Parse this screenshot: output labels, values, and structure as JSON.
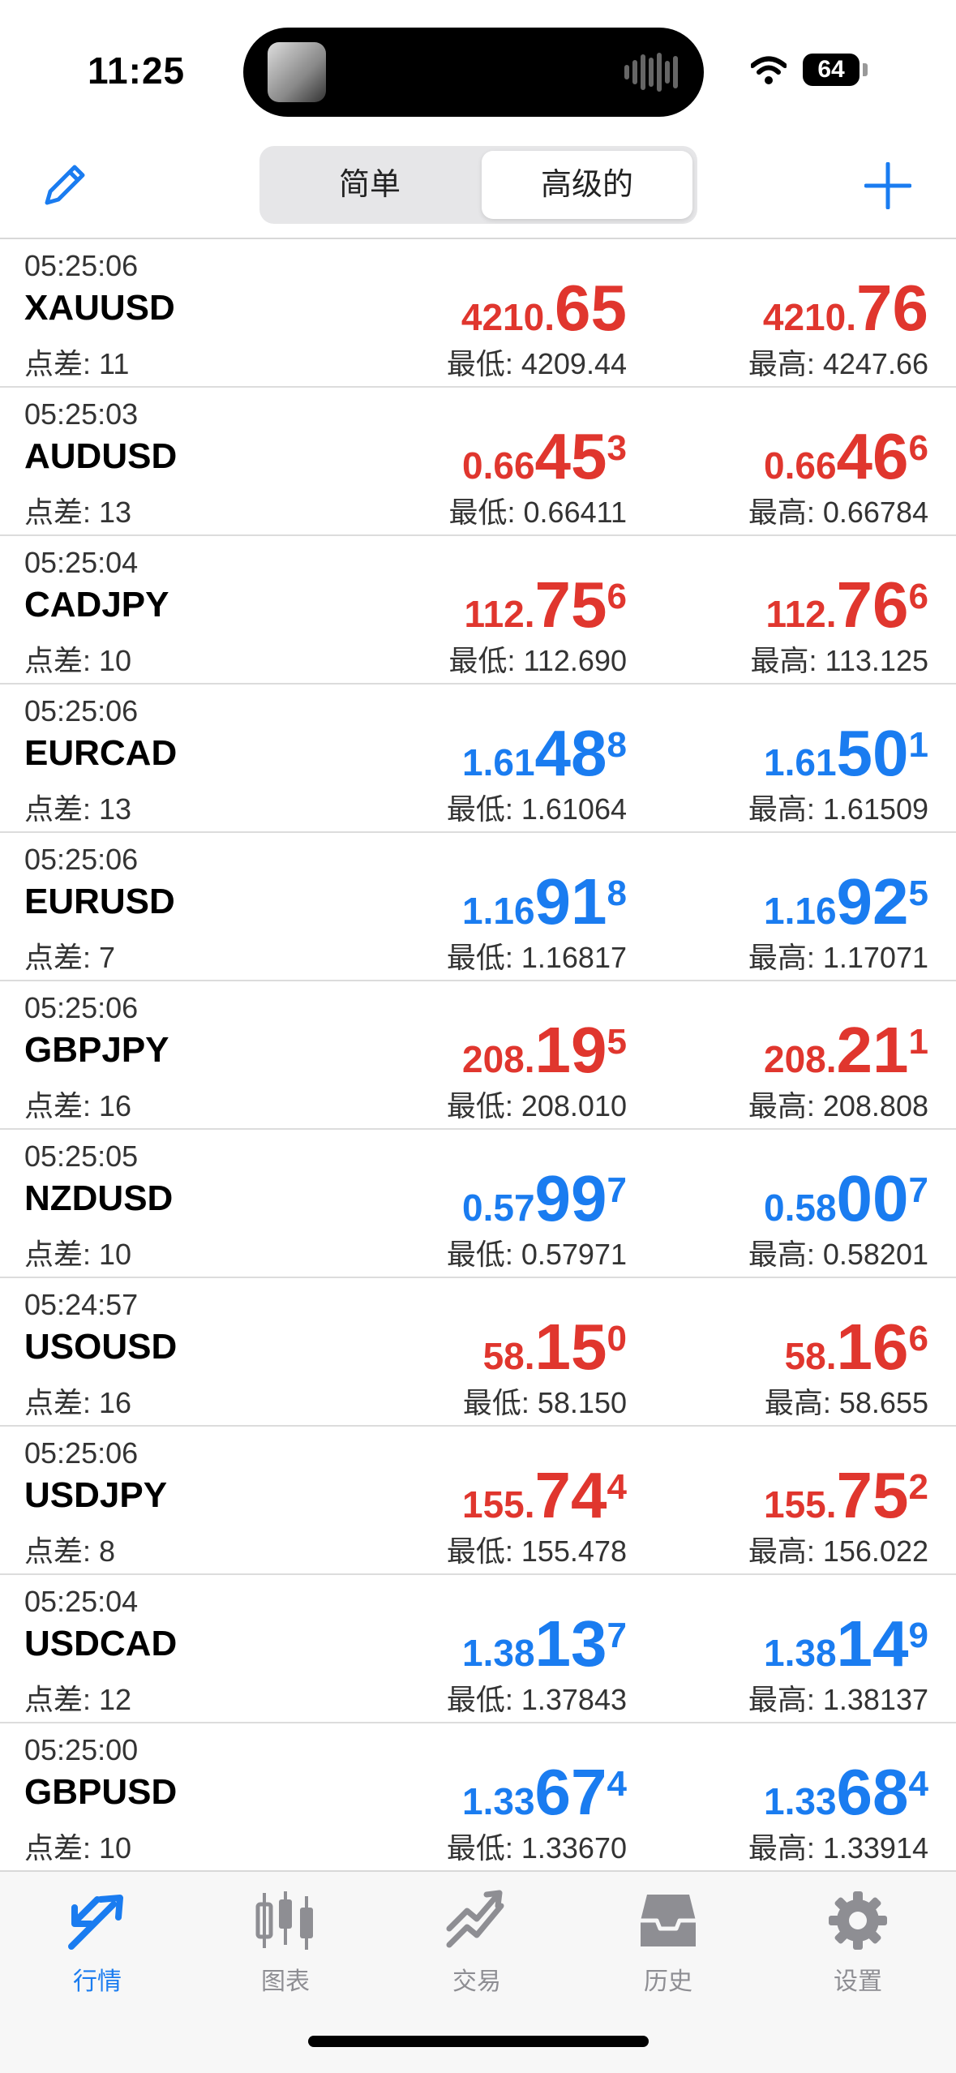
{
  "status": {
    "time": "11:25",
    "battery": "64"
  },
  "header": {
    "seg_simple": "简单",
    "seg_advanced": "高级的"
  },
  "colors": {
    "up": "#e0362e",
    "down": "#1a7cf0",
    "accent": "#1a7cf0"
  },
  "quotes": [
    {
      "time": "05:25:06",
      "symbol": "XAUUSD",
      "spread": "点差: 11",
      "direction": "up",
      "bid": {
        "small": "4210.",
        "big": "65",
        "sup": ""
      },
      "ask": {
        "small": "4210.",
        "big": "76",
        "sup": ""
      },
      "low": "最低: 4209.44",
      "high": "最高: 4247.66"
    },
    {
      "time": "05:25:03",
      "symbol": "AUDUSD",
      "spread": "点差: 13",
      "direction": "up",
      "bid": {
        "small": "0.66",
        "big": "45",
        "sup": "3"
      },
      "ask": {
        "small": "0.66",
        "big": "46",
        "sup": "6"
      },
      "low": "最低: 0.66411",
      "high": "最高: 0.66784"
    },
    {
      "time": "05:25:04",
      "symbol": "CADJPY",
      "spread": "点差: 10",
      "direction": "up",
      "bid": {
        "small": "112.",
        "big": "75",
        "sup": "6"
      },
      "ask": {
        "small": "112.",
        "big": "76",
        "sup": "6"
      },
      "low": "最低: 112.690",
      "high": "最高: 113.125"
    },
    {
      "time": "05:25:06",
      "symbol": "EURCAD",
      "spread": "点差: 13",
      "direction": "down",
      "bid": {
        "small": "1.61",
        "big": "48",
        "sup": "8"
      },
      "ask": {
        "small": "1.61",
        "big": "50",
        "sup": "1"
      },
      "low": "最低: 1.61064",
      "high": "最高: 1.61509"
    },
    {
      "time": "05:25:06",
      "symbol": "EURUSD",
      "spread": "点差: 7",
      "direction": "down",
      "bid": {
        "small": "1.16",
        "big": "91",
        "sup": "8"
      },
      "ask": {
        "small": "1.16",
        "big": "92",
        "sup": "5"
      },
      "low": "最低: 1.16817",
      "high": "最高: 1.17071"
    },
    {
      "time": "05:25:06",
      "symbol": "GBPJPY",
      "spread": "点差: 16",
      "direction": "up",
      "bid": {
        "small": "208.",
        "big": "19",
        "sup": "5"
      },
      "ask": {
        "small": "208.",
        "big": "21",
        "sup": "1"
      },
      "low": "最低: 208.010",
      "high": "最高: 208.808"
    },
    {
      "time": "05:25:05",
      "symbol": "NZDUSD",
      "spread": "点差: 10",
      "direction": "down",
      "bid": {
        "small": "0.57",
        "big": "99",
        "sup": "7"
      },
      "ask": {
        "small": "0.58",
        "big": "00",
        "sup": "7"
      },
      "low": "最低: 0.57971",
      "high": "最高: 0.58201"
    },
    {
      "time": "05:24:57",
      "symbol": "USOUSD",
      "spread": "点差: 16",
      "direction": "up",
      "bid": {
        "small": "58.",
        "big": "15",
        "sup": "0"
      },
      "ask": {
        "small": "58.",
        "big": "16",
        "sup": "6"
      },
      "low": "最低: 58.150",
      "high": "最高: 58.655"
    },
    {
      "time": "05:25:06",
      "symbol": "USDJPY",
      "spread": "点差: 8",
      "direction": "up",
      "bid": {
        "small": "155.",
        "big": "74",
        "sup": "4"
      },
      "ask": {
        "small": "155.",
        "big": "75",
        "sup": "2"
      },
      "low": "最低: 155.478",
      "high": "最高: 156.022"
    },
    {
      "time": "05:25:04",
      "symbol": "USDCAD",
      "spread": "点差: 12",
      "direction": "down",
      "bid": {
        "small": "1.38",
        "big": "13",
        "sup": "7"
      },
      "ask": {
        "small": "1.38",
        "big": "14",
        "sup": "9"
      },
      "low": "最低: 1.37843",
      "high": "最高: 1.38137"
    },
    {
      "time": "05:25:00",
      "symbol": "GBPUSD",
      "spread": "点差: 10",
      "direction": "down",
      "bid": {
        "small": "1.33",
        "big": "67",
        "sup": "4"
      },
      "ask": {
        "small": "1.33",
        "big": "68",
        "sup": "4"
      },
      "low": "最低: 1.33670",
      "high": "最高: 1.33914"
    }
  ],
  "tabs": [
    {
      "label": "行情",
      "icon": "quotes-icon",
      "active": true
    },
    {
      "label": "图表",
      "icon": "chart-icon",
      "active": false
    },
    {
      "label": "交易",
      "icon": "trade-icon",
      "active": false
    },
    {
      "label": "历史",
      "icon": "history-icon",
      "active": false
    },
    {
      "label": "设置",
      "icon": "settings-icon",
      "active": false
    }
  ]
}
